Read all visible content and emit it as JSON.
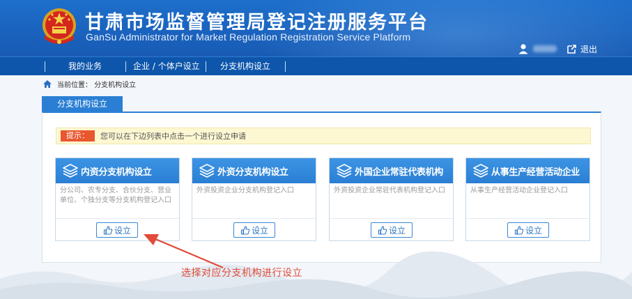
{
  "header": {
    "title_cn": "甘肃市场监督管理局登记注册服务平台",
    "title_en": "GanSu Administrator for Market Regulation Registration Service Platform",
    "logout_label": "退出",
    "user_icon": "user-icon",
    "logout_icon": "logout-icon"
  },
  "nav": {
    "items": [
      {
        "label": "我的业务"
      },
      {
        "label": "企业 / 个体户设立"
      },
      {
        "label": "分支机构设立"
      }
    ]
  },
  "breadcrumb": {
    "home_icon": "home-icon",
    "label": "当前位置：",
    "current": "分支机构设立"
  },
  "panel": {
    "tab_label": "分支机构设立",
    "notice_label": "提示：",
    "notice_text": "您可以在下边列表中点击一个进行设立申请"
  },
  "cards": [
    {
      "title": "内资分支机构设立",
      "desc": "分公司、农专分支、合伙分支、营业单位、个独分支等分支机构登记入口",
      "button": "设立"
    },
    {
      "title": "外资分支机构设立",
      "desc": "外资投资企业分支机构登记入口",
      "button": "设立"
    },
    {
      "title": "外国企业常驻代表机构",
      "desc": "外资投资企业常驻代表机构登记入口",
      "button": "设立"
    },
    {
      "title": "从事生产经营活动企业",
      "desc": "从事生产经营活动企业登记入口",
      "button": "设立"
    }
  ],
  "annotation": {
    "text": "选择对应分支机构进行设立"
  },
  "colors": {
    "header_blue": "#1a62bd",
    "nav_blue": "#0d56ab",
    "card_blue": "#2a7fd4",
    "notice_red": "#e9572f",
    "annotation_red": "#e04b3a"
  }
}
